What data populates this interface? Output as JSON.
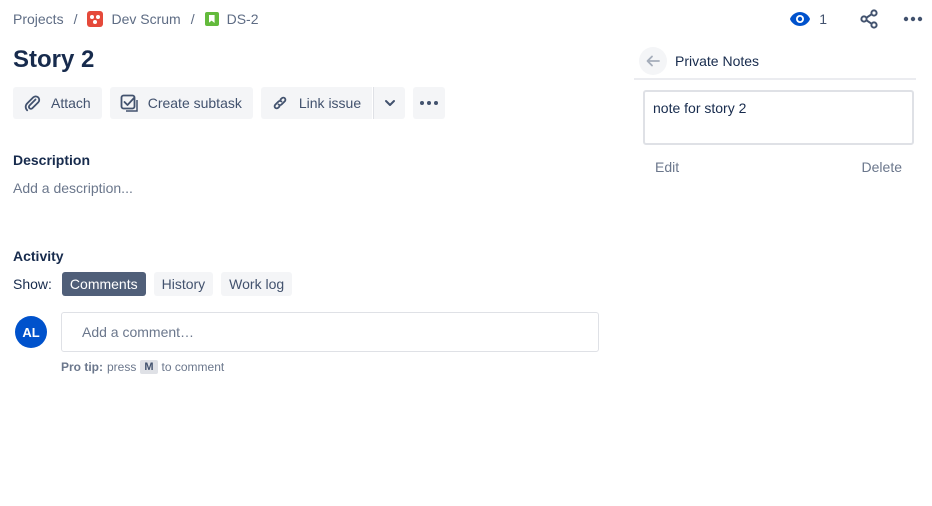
{
  "breadcrumb": {
    "projects": "Projects",
    "separator": "/",
    "project": "Dev Scrum",
    "issue_key": "DS-2"
  },
  "top_actions": {
    "watch_count": "1"
  },
  "issue": {
    "title": "Story 2"
  },
  "toolbar": {
    "attach": "Attach",
    "create_subtask": "Create subtask",
    "link_issue": "Link issue"
  },
  "description": {
    "label": "Description",
    "placeholder": "Add a description..."
  },
  "activity": {
    "label": "Activity",
    "show_label": "Show:",
    "tabs": [
      {
        "label": "Comments",
        "active": true
      },
      {
        "label": "History",
        "active": false
      },
      {
        "label": "Work log",
        "active": false
      }
    ],
    "avatar_initials": "AL",
    "comment_placeholder": "Add a comment…",
    "protip": {
      "bold": "Pro tip:",
      "press": "press",
      "key": "M",
      "suffix": "to comment"
    }
  },
  "private_notes": {
    "title": "Private Notes",
    "note_text": "note for story 2",
    "edit": "Edit",
    "delete": "Delete"
  },
  "colors": {
    "accent": "#0052CC",
    "project_icon": "#E5493A",
    "story_icon": "#63BA3C",
    "active_tab": "#505F79",
    "watch_icon": "#0052CC"
  },
  "icons": {
    "project": "dev-scrum-project-icon",
    "story": "story-icon",
    "watch": "eye-icon",
    "share": "share-icon",
    "more": "more-horizontal-icon",
    "attach": "paperclip-icon",
    "subtask": "subtask-icon",
    "link": "link-icon",
    "dropdown": "chevron-down-icon",
    "back": "arrow-left-icon"
  }
}
